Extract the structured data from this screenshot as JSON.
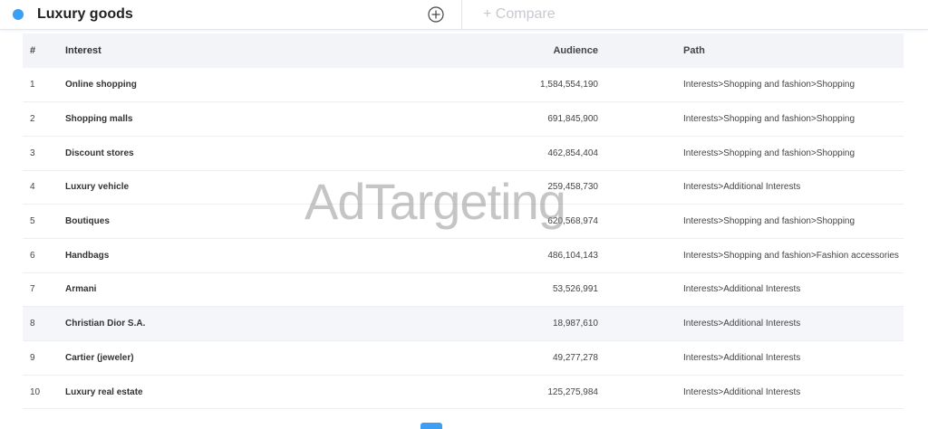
{
  "segment": {
    "title": "Luxury goods",
    "dot_color": "#3b9ff3"
  },
  "compare": {
    "label": "+ Compare"
  },
  "table": {
    "headers": {
      "num": "#",
      "interest": "Interest",
      "audience": "Audience",
      "path": "Path"
    },
    "rows": [
      {
        "num": "1",
        "interest": "Online shopping",
        "audience": "1,584,554,190",
        "path": "Interests>Shopping and fashion>Shopping"
      },
      {
        "num": "2",
        "interest": "Shopping malls",
        "audience": "691,845,900",
        "path": "Interests>Shopping and fashion>Shopping"
      },
      {
        "num": "3",
        "interest": "Discount stores",
        "audience": "462,854,404",
        "path": "Interests>Shopping and fashion>Shopping"
      },
      {
        "num": "4",
        "interest": "Luxury vehicle",
        "audience": "259,458,730",
        "path": "Interests>Additional Interests"
      },
      {
        "num": "5",
        "interest": "Boutiques",
        "audience": "620,568,974",
        "path": "Interests>Shopping and fashion>Shopping"
      },
      {
        "num": "6",
        "interest": "Handbags",
        "audience": "486,104,143",
        "path": "Interests>Shopping and fashion>Fashion accessories"
      },
      {
        "num": "7",
        "interest": "Armani",
        "audience": "53,526,991",
        "path": "Interests>Additional Interests"
      },
      {
        "num": "8",
        "interest": "Christian Dior S.A.",
        "audience": "18,987,610",
        "path": "Interests>Additional Interests"
      },
      {
        "num": "9",
        "interest": "Cartier (jeweler)",
        "audience": "49,277,278",
        "path": "Interests>Additional Interests"
      },
      {
        "num": "10",
        "interest": "Luxury real estate",
        "audience": "125,275,984",
        "path": "Interests>Additional Interests"
      }
    ]
  },
  "watermark": {
    "text": "AdTargeting"
  }
}
